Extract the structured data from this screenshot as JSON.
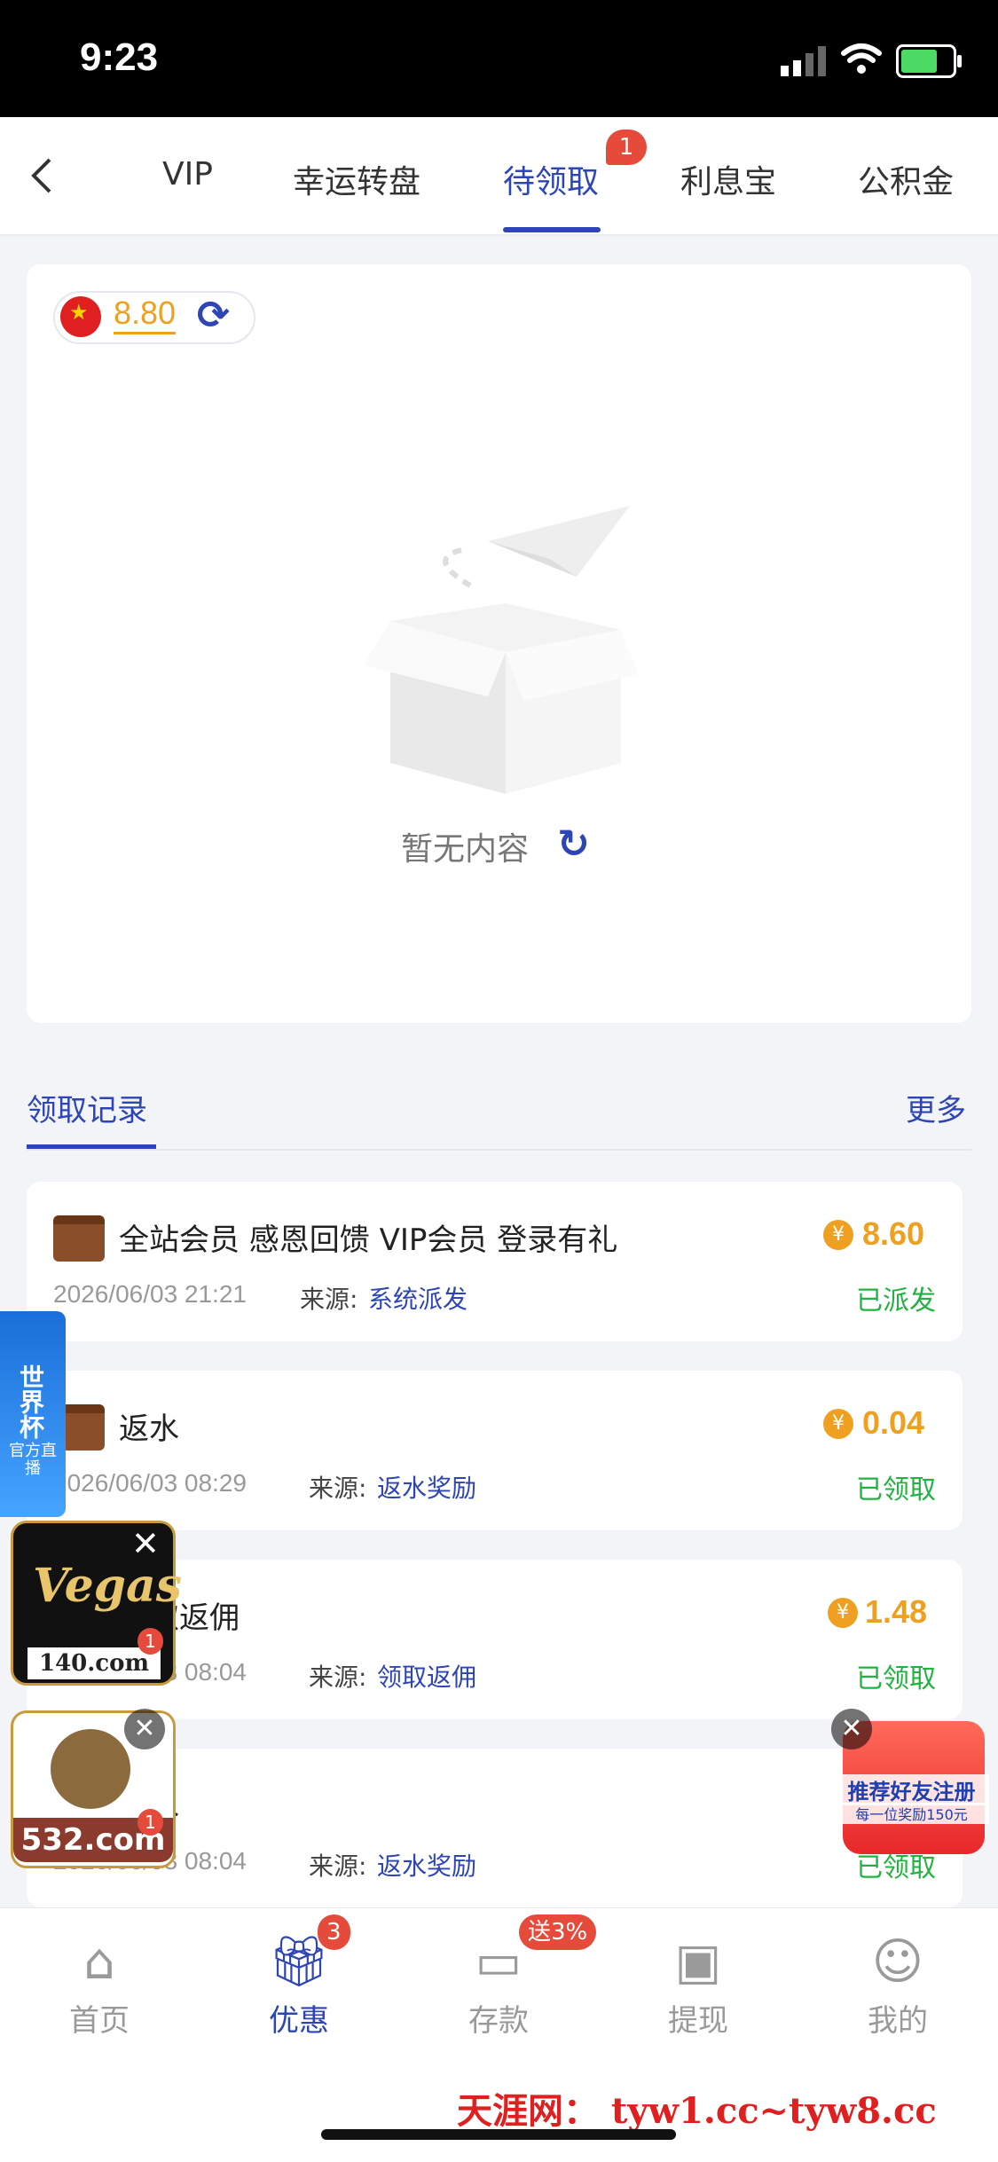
{
  "status_bar": {
    "time": "9:23"
  },
  "nav": {
    "tabs": [
      {
        "label": "VIP"
      },
      {
        "label": "幸运转盘"
      },
      {
        "label": "待领取",
        "badge": "1"
      },
      {
        "label": "利息宝"
      },
      {
        "label": "公积金"
      }
    ],
    "active": "待领取"
  },
  "balance": {
    "value": "8.80"
  },
  "empty": {
    "text": "暂无内容"
  },
  "records": {
    "title": "领取记录",
    "more": "更多",
    "source_label": "来源:",
    "items": [
      {
        "title": "全站会员 感恩回馈 VIP会员 登录有礼",
        "amount": "8.60",
        "date": "2026/06/03 21:21",
        "source": "系统派发",
        "status": "已派发"
      },
      {
        "title": "返水",
        "amount": "0.04",
        "date": "2026/06/03 08:29",
        "source": "返水奖励",
        "status": "已领取"
      },
      {
        "title": "领取返佣",
        "amount": "1.48",
        "date": "2026/06/03 08:04",
        "source": "领取返佣",
        "status": "已领取"
      },
      {
        "title": "返水",
        "amount": "",
        "date": "2026/06/03 08:04",
        "source": "返水奖励",
        "status": "已领取"
      }
    ]
  },
  "ads": {
    "worldcup": "世界杯",
    "worldcup_sub": "官方直播",
    "vegas_site": "140.com",
    "site2": "532.com",
    "badge": "1",
    "referral": "推荐好友注册",
    "referral_sub": "每一位奖励150元"
  },
  "bottom_nav": {
    "items": [
      {
        "label": "首页"
      },
      {
        "label": "优惠",
        "badge": "3"
      },
      {
        "label": "存款",
        "badge": "送3%"
      },
      {
        "label": "提现"
      },
      {
        "label": "我的"
      }
    ]
  },
  "watermark": "天涯网： tyw1.cc~tyw8.cc",
  "colors": {
    "accent": "#2d45b5",
    "amount": "#f0a020",
    "success": "#21b33f",
    "badge": "#e54a3a"
  }
}
